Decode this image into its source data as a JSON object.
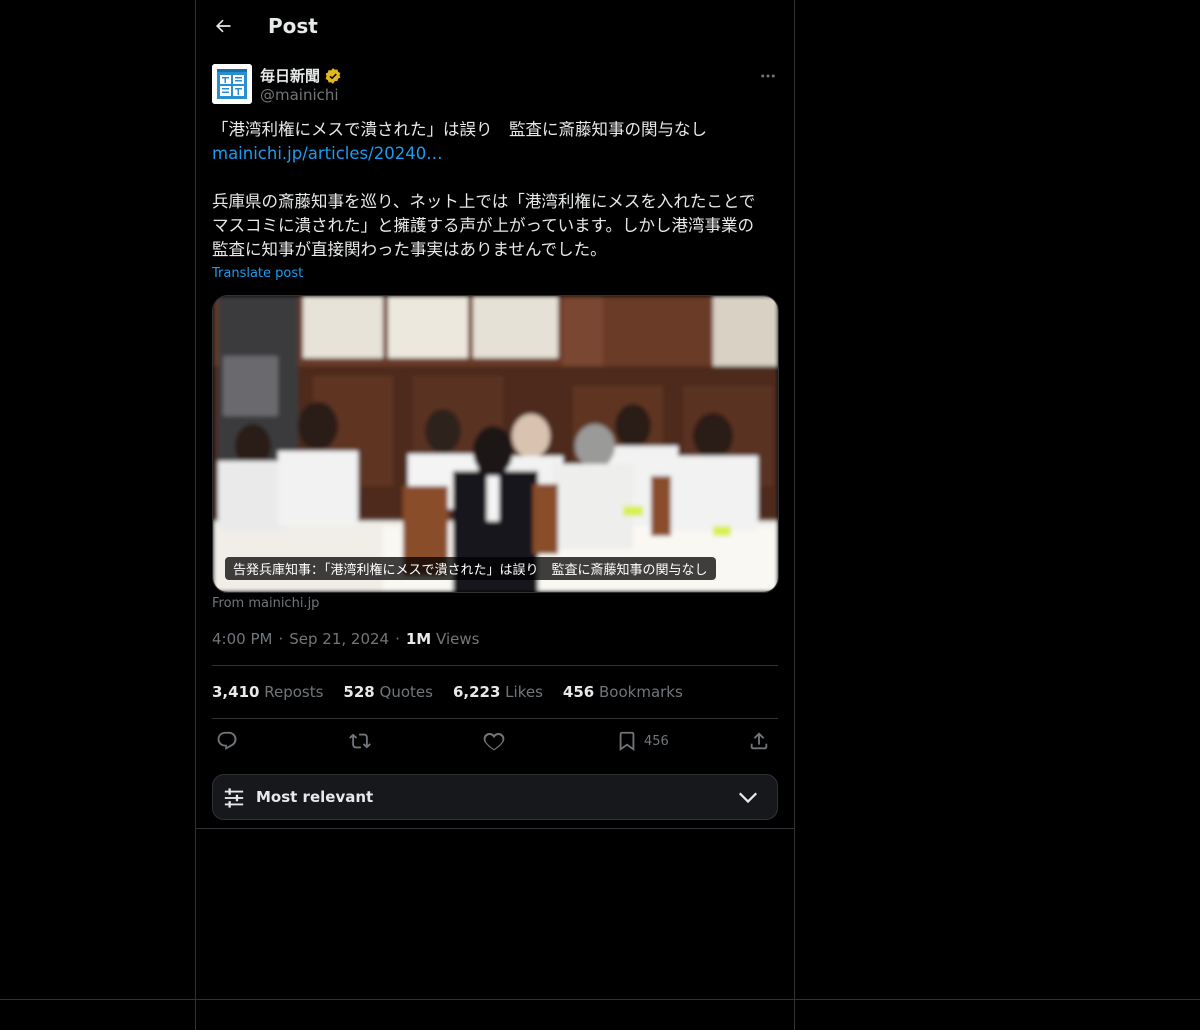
{
  "header": {
    "title": "Post"
  },
  "author": {
    "name": "毎日新聞",
    "handle": "@mainichi",
    "avatar_text_top": "新毎",
    "avatar_text_bottom": "聞日"
  },
  "tweet": {
    "headline": "「港湾利権にメスで潰された」は誤り　監査に斎藤知事の関与なし",
    "link": "mainichi.jp/articles/20240…",
    "body_line1": "兵庫県の斎藤知事を巡り、ネット上では「港湾利権にメスを入れたことで",
    "body_line2": "マスコミに潰された」と擁護する声が上がっています。しかし港湾事業の",
    "body_line3": "監査に知事が直接関わった事実はありませんでした。",
    "translate": "Translate post"
  },
  "media": {
    "caption": "告発兵庫知事：「港湾利権にメスで潰された」は誤り　監査に斎藤知事の関与なし",
    "source": "From mainichi.jp"
  },
  "meta": {
    "time": "4:00 PM",
    "date": "Sep 21, 2024",
    "views_count": "1M",
    "views_label": "Views",
    "sep": "·"
  },
  "stats": {
    "reposts_count": "3,410",
    "reposts_label": "Reposts",
    "quotes_count": "528",
    "quotes_label": "Quotes",
    "likes_count": "6,223",
    "likes_label": "Likes",
    "bookmarks_count": "456",
    "bookmarks_label": "Bookmarks"
  },
  "actions": {
    "bookmark_count": "456",
    "icons": [
      "reply-icon",
      "repost-icon",
      "like-icon",
      "bookmark-icon",
      "share-icon"
    ]
  },
  "sort": {
    "label": "Most relevant"
  },
  "colors": {
    "background": "#000000",
    "text": "#e7e9ea",
    "muted": "#71767b",
    "link": "#1d9bf0",
    "border": "#2f3336",
    "verified": "#e2b719"
  }
}
